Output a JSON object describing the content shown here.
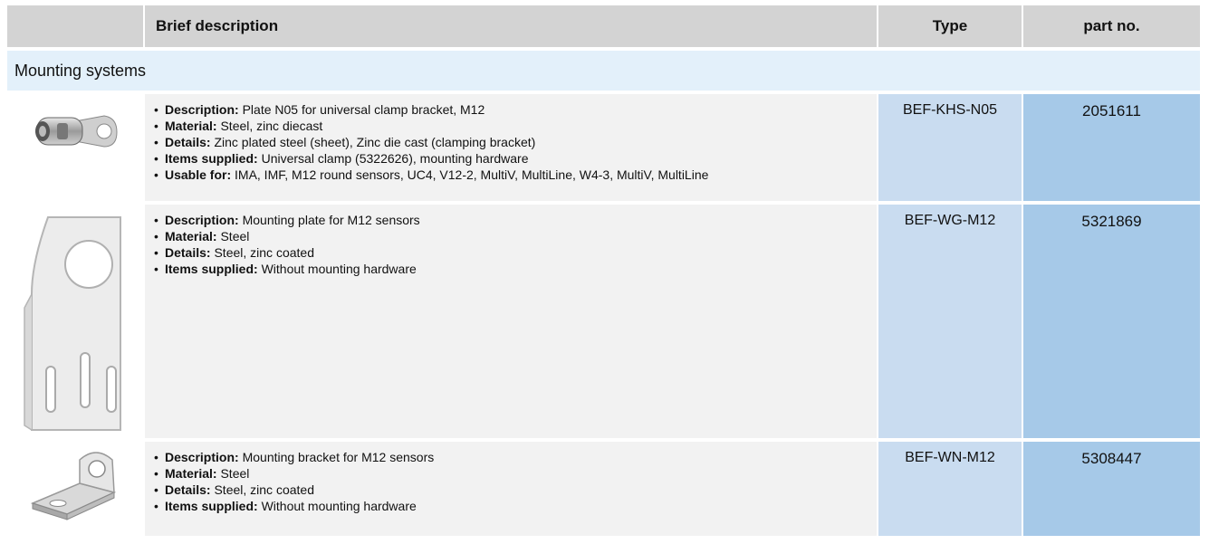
{
  "header": {
    "brief_description": "Brief description",
    "type": "Type",
    "part_no": "part no."
  },
  "section_title": "Mounting systems",
  "rows": [
    {
      "image_icon": "clamp-bracket-plate-icon",
      "items": [
        {
          "label": "Description:",
          "value": "Plate N05 for universal clamp bracket, M12"
        },
        {
          "label": "Material:",
          "value": "Steel, zinc diecast"
        },
        {
          "label": "Details:",
          "value": "Zinc plated steel (sheet), Zinc die cast (clamping bracket)"
        },
        {
          "label": "Items supplied:",
          "value": "Universal clamp (5322626), mounting hardware"
        },
        {
          "label": "Usable for:",
          "value": "IMA, IMF, M12 round sensors, UC4, V12-2, MultiV, MultiLine, W4-3, MultiV, MultiLine"
        }
      ],
      "type": "BEF-KHS-N05",
      "part_no": "2051611"
    },
    {
      "image_icon": "mounting-plate-icon",
      "items": [
        {
          "label": "Description:",
          "value": "Mounting plate for M12 sensors"
        },
        {
          "label": "Material:",
          "value": "Steel"
        },
        {
          "label": "Details:",
          "value": "Steel, zinc coated"
        },
        {
          "label": "Items supplied:",
          "value": "Without mounting hardware"
        }
      ],
      "type": "BEF-WG-M12",
      "part_no": "5321869"
    },
    {
      "image_icon": "mounting-bracket-icon",
      "items": [
        {
          "label": "Description:",
          "value": "Mounting bracket for M12 sensors"
        },
        {
          "label": "Material:",
          "value": "Steel"
        },
        {
          "label": "Details:",
          "value": "Steel, zinc coated"
        },
        {
          "label": "Items supplied:",
          "value": "Without mounting hardware"
        }
      ],
      "type": "BEF-WN-M12",
      "part_no": "5308447"
    }
  ]
}
